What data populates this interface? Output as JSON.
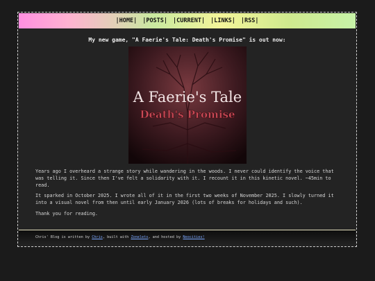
{
  "nav": {
    "home": "|HOME|",
    "posts": "|POSTS|",
    "current": "|CURRENT|",
    "links": "|LINKS|",
    "rss": "|RSS|"
  },
  "announcement": "My new game, \"A Faerie's Tale: Death's Promise\" is out now:",
  "cover": {
    "title": "A Faerie's Tale",
    "subtitle": "Death's Promise"
  },
  "paragraphs": [
    "Years ago I overheard a strange story while wandering in the woods. I never could identify the voice that was telling it. Since then I've felt a solidarity with it. I recount it in this kinetic novel. ~45min to read.",
    "It sparked in October 2025. I wrote all of it in the first two weeks of November 2025. I slowly turned it into a visual novel from then until early January 2026 (lots of breaks for holidays and such).",
    "Thank you for reading."
  ],
  "footer": {
    "text1": "Chris' Blog is written by ",
    "author_link": "Chris",
    "text2": ", built with ",
    "builder_link": "Zonelets",
    "text3": ", and hosted by ",
    "host_link": "Neocities!"
  },
  "colors": {
    "page_bg": "#1b1b1b",
    "content_bg": "#232323",
    "link": "#7aa7ff",
    "cover_red": "#c74a55"
  }
}
